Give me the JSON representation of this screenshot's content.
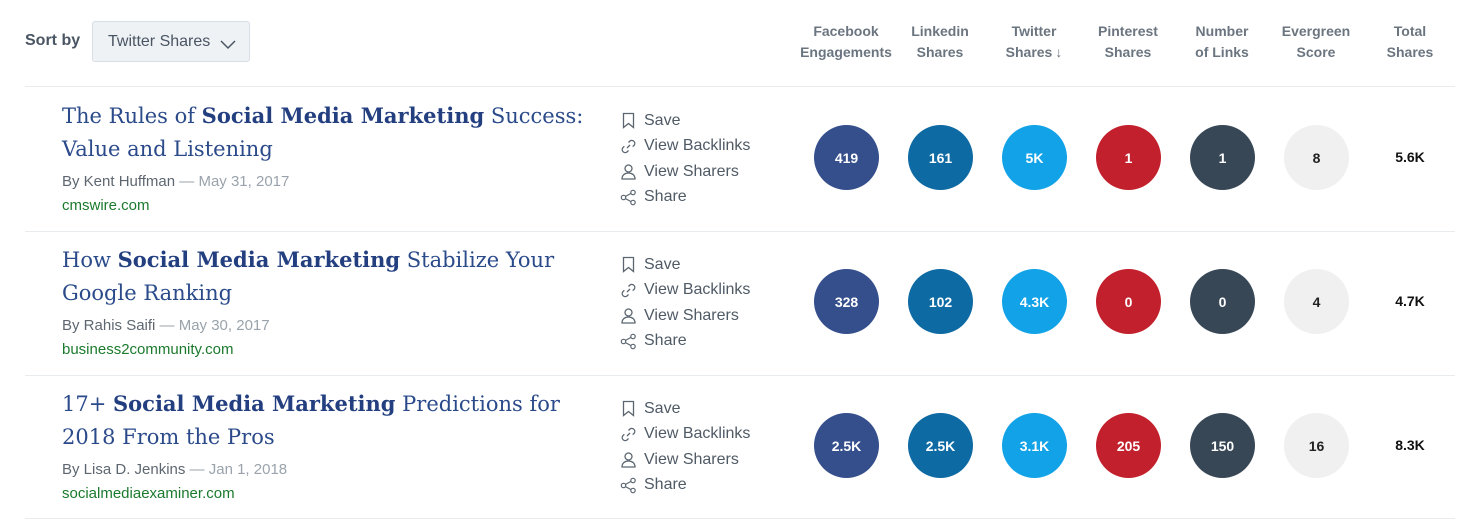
{
  "sort": {
    "label": "Sort by",
    "selected": "Twitter Shares"
  },
  "columns": [
    {
      "line1": "Facebook",
      "line2": "Engagements"
    },
    {
      "line1": "Linkedin",
      "line2": "Shares"
    },
    {
      "line1": "Twitter",
      "line2": "Shares",
      "sorted": true,
      "arrow": "↓"
    },
    {
      "line1": "Pinterest",
      "line2": "Shares"
    },
    {
      "line1": "Number",
      "line2": "of Links"
    },
    {
      "line1": "Evergreen",
      "line2": "Score"
    },
    {
      "line1": "Total",
      "line2": "Shares"
    }
  ],
  "action_labels": {
    "save": "Save",
    "backlinks": "View Backlinks",
    "sharers": "View Sharers",
    "share": "Share"
  },
  "colors": {
    "facebook": "#354f8c",
    "linkedin": "#0d6aa3",
    "twitter": "#12a2e8",
    "pinterest": "#c2202c",
    "links": "#374756",
    "evergreen": "#f0f0f0",
    "domain": "#1b7a2d",
    "title": "#2a4a8a"
  },
  "rows": [
    {
      "title_pre": "The Rules of ",
      "title_bold": "Social Media Marketing",
      "title_post": " Success: Value and Listening",
      "author": "By Kent Huffman",
      "date": " — May 31, 2017",
      "domain": "cmswire.com",
      "facebook": "419",
      "linkedin": "161",
      "twitter": "5K",
      "pinterest": "1",
      "links": "1",
      "evergreen": "8",
      "total": "5.6K"
    },
    {
      "title_pre": "How ",
      "title_bold": "Social Media Marketing",
      "title_post": " Stabilize Your Google Ranking",
      "author": "By Rahis Saifi",
      "date": " — May 30, 2017",
      "domain": "business2community.com",
      "facebook": "328",
      "linkedin": "102",
      "twitter": "4.3K",
      "pinterest": "0",
      "links": "0",
      "evergreen": "4",
      "total": "4.7K"
    },
    {
      "title_pre": "17+ ",
      "title_bold": "Social Media Marketing",
      "title_post": " Predictions for 2018 From the Pros",
      "author": "By Lisa D. Jenkins",
      "date": " — Jan 1, 2018",
      "domain": "socialmediaexaminer.com",
      "facebook": "2.5K",
      "linkedin": "2.5K",
      "twitter": "3.1K",
      "pinterest": "205",
      "links": "150",
      "evergreen": "16",
      "total": "8.3K"
    }
  ]
}
